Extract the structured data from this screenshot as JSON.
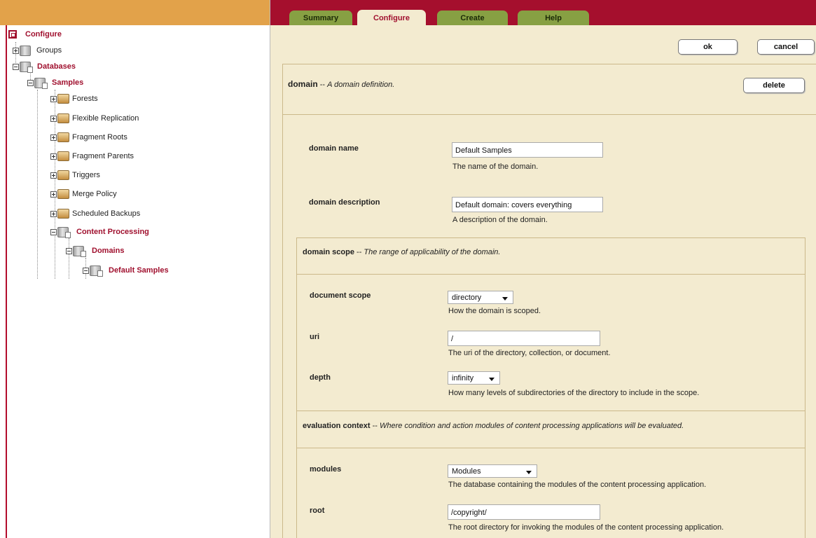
{
  "tabs": [
    "Summary",
    "Configure",
    "Create",
    "Help"
  ],
  "buttons": {
    "ok": "ok",
    "cancel": "cancel",
    "delete": "delete"
  },
  "tree": {
    "configure": "Configure",
    "groups": "Groups",
    "databases": "Databases",
    "samples": "Samples",
    "forests": "Forests",
    "flexible_replication": "Flexible Replication",
    "fragment_roots": "Fragment Roots",
    "fragment_parents": "Fragment Parents",
    "triggers": "Triggers",
    "merge_policy": "Merge Policy",
    "scheduled_backups": "Scheduled Backups",
    "content_processing": "Content Processing",
    "domains": "Domains",
    "default_samples": "Default Samples"
  },
  "domain": {
    "title": "domain",
    "desc": "A domain definition."
  },
  "fields": {
    "domain_name": {
      "label": "domain name",
      "value": "Default Samples",
      "help": "The name of the domain."
    },
    "domain_description": {
      "label": "domain description",
      "value": "Default domain: covers everything",
      "help": "A description of the domain."
    }
  },
  "scope": {
    "title": "domain scope",
    "desc": "The range of applicability of the domain.",
    "document_scope": {
      "label": "document scope",
      "value": "directory",
      "help": "How the domain is scoped."
    },
    "uri": {
      "label": "uri",
      "value": "/",
      "help": "The uri of the directory, collection, or document."
    },
    "depth": {
      "label": "depth",
      "value": "infinity",
      "help": "How many levels of subdirectories of the directory to include in the scope."
    }
  },
  "eval": {
    "title": "evaluation context",
    "desc": "Where condition and action modules of content processing applications will be evaluated.",
    "modules": {
      "label": "modules",
      "value": "Modules",
      "help": "The database containing the modules of the content processing application."
    },
    "root": {
      "label": "root",
      "value": "/copyright/",
      "help": "The root directory for invoking the modules of the content processing application."
    }
  }
}
